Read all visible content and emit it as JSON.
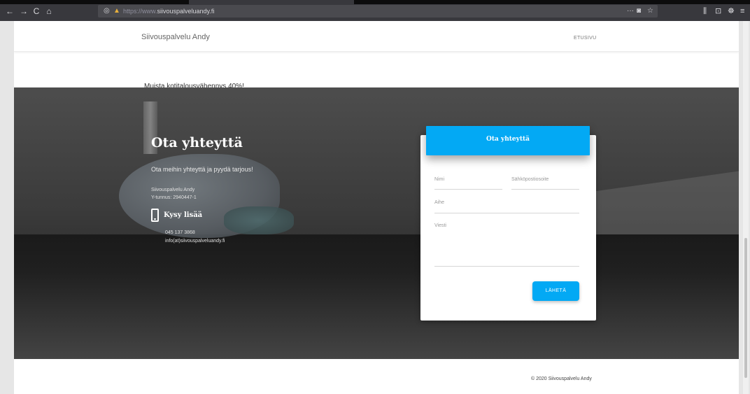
{
  "browser": {
    "url_scheme": "https://www.",
    "url_host": "siivouspalveluandy.fi",
    "back_icon": "←",
    "forward_icon": "→",
    "reload_icon": "C",
    "home_icon": "⌂",
    "shield_icon": "◎",
    "lock_icon": "▲",
    "more_icon": "···",
    "pocket_icon": "◙",
    "star_icon": "☆",
    "library_icon": "⫼",
    "reader_icon": "⊡",
    "extension_icon": "☸",
    "menu_icon": "≡"
  },
  "header": {
    "brand": "Siivouspalvelu Andy",
    "nav_link": "ETUSIVU"
  },
  "notice": "Muista kotitalousvähennys 40%!",
  "contact": {
    "title": "Ota yhteyttä",
    "lead": "Ota meihin yhteyttä ja pyydä tarjous!",
    "company_name": "Siivouspalvelu Andy",
    "business_id": "Y-tunnus: 2940447-1",
    "ask_label": "Kysy lisää",
    "phone": "045 137 3868",
    "email": "info(at)siivouspalveluandy.fi"
  },
  "form": {
    "title": "Ota yhteyttä",
    "name_placeholder": "Nimi",
    "email_placeholder": "Sähköpostiosoite",
    "subject_placeholder": "Aihe",
    "message_placeholder": "Viesti",
    "submit_label": "LÄHETÄ"
  },
  "footer": {
    "copyright": "© 2020 Siivouspalvelu Andy"
  },
  "colors": {
    "accent": "#03a9f4",
    "browser_chrome": "#38383d"
  }
}
